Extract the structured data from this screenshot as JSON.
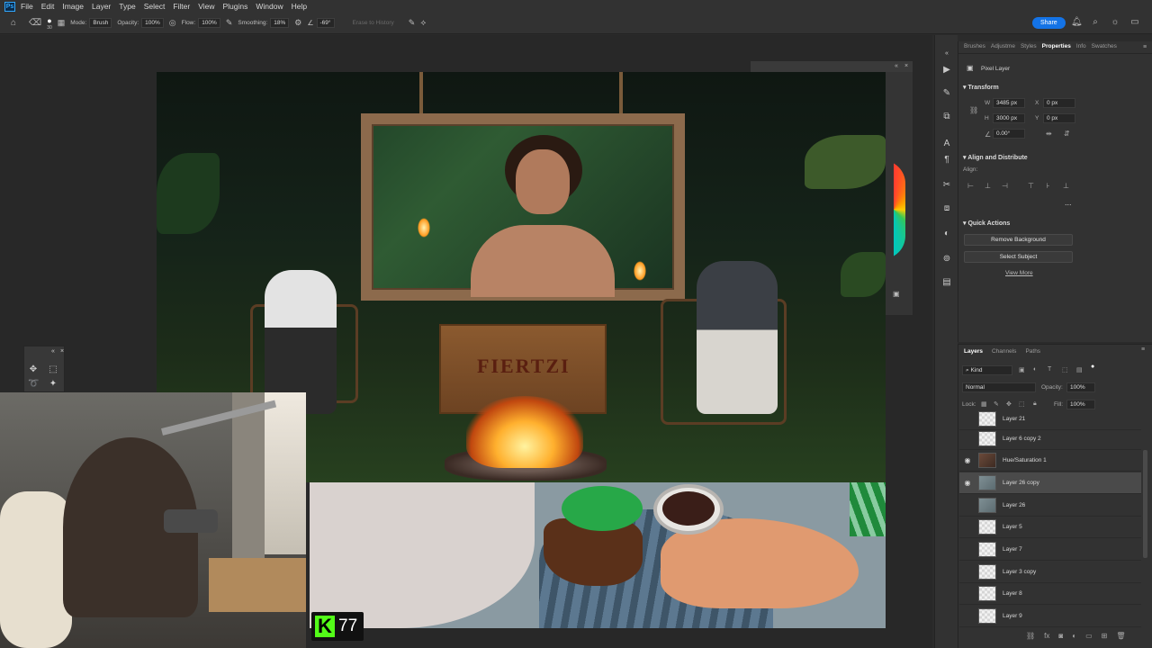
{
  "app": {
    "logo": "Ps"
  },
  "menu": [
    "File",
    "Edit",
    "Image",
    "Layer",
    "Type",
    "Select",
    "Filter",
    "View",
    "Plugins",
    "Window",
    "Help"
  ],
  "options_bar": {
    "brush_size": "30",
    "mode_label": "Mode:",
    "mode_value": "Brush",
    "opacity_label": "Opacity:",
    "opacity_value": "100%",
    "flow_label": "Flow:",
    "flow_value": "100%",
    "smoothing_label": "Smoothing:",
    "smoothing_value": "18%",
    "angle_value": "-69°",
    "erase_history": "Erase to History"
  },
  "share_label": "Share",
  "canvas": {
    "crate_text": "FIERTZI"
  },
  "kick": {
    "logo": "K",
    "count": "77"
  },
  "properties": {
    "tabs": [
      "Brushes",
      "Adjustme",
      "Styles",
      "Properties",
      "Info",
      "Swatches"
    ],
    "active_tab": "Properties",
    "kind": "Pixel Layer",
    "transform_title": "Transform",
    "w_label": "W",
    "w_value": "3485 px",
    "h_label": "H",
    "h_value": "3000 px",
    "x_label": "X",
    "x_value": "0 px",
    "y_label": "Y",
    "y_value": "0 px",
    "angle_value": "0.00°",
    "align_title": "Align and Distribute",
    "align_label": "Align:",
    "more": "...",
    "quick_actions_title": "Quick Actions",
    "remove_bg": "Remove Background",
    "select_subject": "Select Subject",
    "view_more": "View More"
  },
  "layers": {
    "tabs": [
      "Layers",
      "Channels",
      "Paths"
    ],
    "active_tab": "Layers",
    "filter_kind": "Kind",
    "blend_mode": "Normal",
    "opacity_label": "Opacity:",
    "opacity_value": "100%",
    "lock_label": "Lock:",
    "fill_label": "Fill:",
    "fill_value": "100%",
    "items": [
      {
        "name": "Layer 21",
        "visible": false
      },
      {
        "name": "Layer 6 copy 2",
        "visible": false
      },
      {
        "name": "Hue/Saturation 1",
        "visible": true
      },
      {
        "name": "Layer 26 copy",
        "visible": true,
        "selected": true
      },
      {
        "name": "Layer 26",
        "visible": false
      },
      {
        "name": "Layer 5",
        "visible": false
      },
      {
        "name": "Layer 7",
        "visible": false
      },
      {
        "name": "Layer 3 copy",
        "visible": false
      },
      {
        "name": "Layer 8",
        "visible": false
      },
      {
        "name": "Layer 9",
        "visible": false
      }
    ]
  },
  "colors": {
    "accent": "#1473e6",
    "kick_green": "#53fc18"
  }
}
